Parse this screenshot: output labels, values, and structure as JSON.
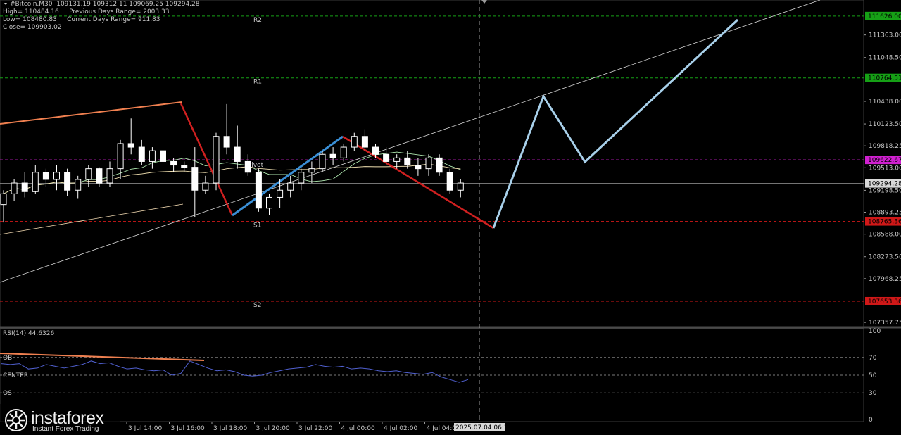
{
  "header": {
    "symbol": "#Bitcoin,M30",
    "ohlc": "109131.19 109312.11 109069.25 109294.28",
    "high": "High= 110484.16",
    "prev_range": "Previous Days Range= 2003.33",
    "low": "Low= 108480.83",
    "cur_range": "Current Days Range= 911.83",
    "close": "Close= 109903.02"
  },
  "brand": {
    "name": "instaforex",
    "tagline": "Instant Forex Trading"
  },
  "colors": {
    "background": "#000000",
    "candle": "#ffffff",
    "grid": "#3a3a3a",
    "pivot_level": "#d020d0",
    "resistance_level": "#16a016",
    "support_level": "#d01818",
    "price_level": "#9a9a9a",
    "red_trendline": "#d02020",
    "blue_trendline": "#3a8fd6",
    "projection": "#a8d0ea",
    "orange_trendline": "#f08050",
    "rsi_line": "#5060d0"
  },
  "chart_data": {
    "type": "candlestick",
    "symbol": "#Bitcoin",
    "timeframe": "M30",
    "y_ticks": [
      111626.0,
      111363.0,
      111048.5,
      110764.51,
      110438.0,
      110123.5,
      109818.25,
      109622.67,
      109513.0,
      109294.28,
      109198.5,
      108893.25,
      108765.36,
      108588.0,
      108273.5,
      107968.25,
      107653.36,
      107357.75
    ],
    "ylim": [
      107300,
      111850
    ],
    "x_tick_labels": [
      "3 Jul 14:00",
      "3 Jul 16:00",
      "3 Jul 18:00",
      "3 Jul 20:00",
      "3 Jul 22:00",
      "4 Jul 00:00",
      "4 Jul 02:00",
      "4 Jul 04:00"
    ],
    "x_current_label": "2025.07.04 06:30",
    "levels": [
      {
        "name": "R2",
        "value": 111626.0,
        "label": "111626.00",
        "kind": "resistance"
      },
      {
        "name": "R1",
        "value": 110764.51,
        "label": "110764.51",
        "kind": "resistance"
      },
      {
        "name": "Pivot",
        "value": 109622.67,
        "label": "109622.67",
        "kind": "pivot"
      },
      {
        "name": "S1",
        "value": 108765.36,
        "label": "108765.36",
        "kind": "support"
      },
      {
        "name": "S2",
        "value": 107653.36,
        "label": "107653.36",
        "kind": "support"
      }
    ],
    "last_price": {
      "value": 109294.28,
      "label": "109294.28"
    },
    "candles": [
      [
        109000,
        109200,
        108750,
        109150
      ],
      [
        109150,
        109350,
        109050,
        109300
      ],
      [
        109300,
        109450,
        109100,
        109180
      ],
      [
        109180,
        109550,
        109150,
        109450
      ],
      [
        109450,
        109500,
        109250,
        109350
      ],
      [
        109350,
        109550,
        109200,
        109450
      ],
      [
        109450,
        109500,
        109120,
        109200
      ],
      [
        109200,
        109400,
        109080,
        109350
      ],
      [
        109350,
        109550,
        109250,
        109500
      ],
      [
        109500,
        109520,
        109250,
        109300
      ],
      [
        109300,
        109600,
        109250,
        109500
      ],
      [
        109500,
        109900,
        109350,
        109850
      ],
      [
        109850,
        110200,
        109700,
        109800
      ],
      [
        109800,
        109900,
        109550,
        109600
      ],
      [
        109600,
        109800,
        109500,
        109750
      ],
      [
        109750,
        109800,
        109550,
        109600
      ],
      [
        109600,
        109650,
        109450,
        109550
      ],
      [
        109550,
        109600,
        109450,
        109520
      ],
      [
        109520,
        109800,
        108830,
        109200
      ],
      [
        109200,
        109400,
        109150,
        109300
      ],
      [
        109300,
        110000,
        109200,
        109950
      ],
      [
        109950,
        110400,
        109700,
        109800
      ],
      [
        109800,
        110100,
        109500,
        109600
      ],
      [
        109600,
        109700,
        109400,
        109450
      ],
      [
        109450,
        109500,
        108900,
        108950
      ],
      [
        108950,
        109150,
        108850,
        109100
      ],
      [
        109100,
        109350,
        108950,
        109200
      ],
      [
        109200,
        109400,
        109100,
        109300
      ],
      [
        109300,
        109500,
        109200,
        109450
      ],
      [
        109450,
        109600,
        109300,
        109500
      ],
      [
        109500,
        109750,
        109450,
        109700
      ],
      [
        109700,
        109800,
        109550,
        109650
      ],
      [
        109650,
        109850,
        109600,
        109800
      ],
      [
        109800,
        110000,
        109750,
        109950
      ],
      [
        109950,
        110050,
        109750,
        109800
      ],
      [
        109800,
        109850,
        109650,
        109700
      ],
      [
        109700,
        109800,
        109550,
        109600
      ],
      [
        109600,
        109700,
        109500,
        109650
      ],
      [
        109650,
        109750,
        109500,
        109550
      ],
      [
        109550,
        109650,
        109400,
        109500
      ],
      [
        109500,
        109700,
        109400,
        109650
      ],
      [
        109650,
        109700,
        109400,
        109450
      ],
      [
        109450,
        109500,
        109150,
        109200
      ],
      [
        109200,
        109350,
        109100,
        109300
      ]
    ],
    "rsi": {
      "label": "RSI(14) 44.6326",
      "ylim": [
        0,
        100
      ],
      "levels": [
        {
          "value": 70,
          "label": "OB"
        },
        {
          "value": 50,
          "label": "CENTER"
        },
        {
          "value": 30,
          "label": "OS"
        }
      ],
      "y_ticks": [
        100,
        70,
        50,
        30,
        0
      ],
      "values": [
        63,
        62,
        63,
        57,
        58,
        62,
        60,
        58,
        60,
        62,
        66,
        63,
        64,
        60,
        57,
        58,
        56,
        55,
        56,
        50,
        52,
        66,
        62,
        58,
        55,
        56,
        54,
        50,
        49,
        50,
        53,
        55,
        57,
        58,
        59,
        62,
        60,
        59,
        60,
        57,
        58,
        57,
        55,
        54,
        55,
        53,
        52,
        51,
        53,
        48,
        45,
        42,
        45
      ]
    }
  }
}
